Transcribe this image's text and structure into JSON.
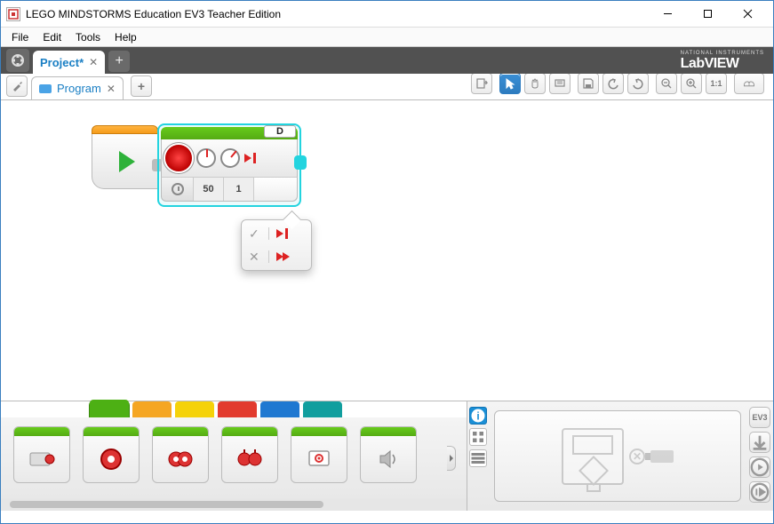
{
  "app": {
    "title": "LEGO MINDSTORMS Education EV3 Teacher Edition"
  },
  "menu": {
    "file": "File",
    "edit": "Edit",
    "tools": "Tools",
    "help": "Help"
  },
  "brand": {
    "small": "NATIONAL INSTRUMENTS",
    "big": "LabVIEW"
  },
  "project_tab": {
    "label": "Project*"
  },
  "program_tab": {
    "label": "Program"
  },
  "motor": {
    "port": "D",
    "power": "50",
    "rotations": "1"
  },
  "palette": {
    "colors": [
      "#4db014",
      "#f5a623",
      "#f5d20a",
      "#e23b2e",
      "#1f78d1",
      "#119e9e"
    ]
  },
  "hw_label": "EV3"
}
